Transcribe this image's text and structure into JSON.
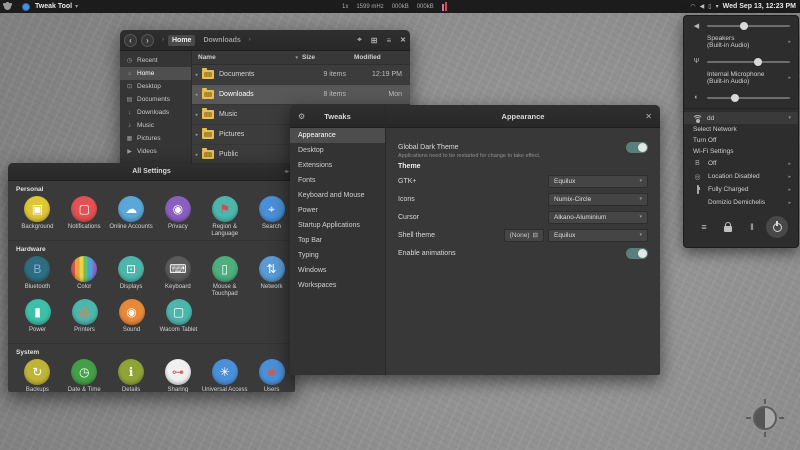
{
  "colors": {
    "accent": "#587f7b",
    "folder": "#e9c050"
  },
  "glyphs": {
    "caret_down": "▾",
    "chevron": "›",
    "back": "‹",
    "forward": "›",
    "expander": "▸",
    "sort_desc": "▾",
    "search": "⌖",
    "grid": "⊞",
    "menu": "≡",
    "close": "✕",
    "gear": "⚙",
    "submenu": "›",
    "folder_button": "⊟",
    "tb_network": "◠",
    "tb_volume": "◀",
    "tb_battery": "▯"
  },
  "top_bar": {
    "app_name": "Tweak Tool",
    "monitor": {
      "scale": "1x",
      "cpu": "1599 mHz",
      "net_down": "000kB",
      "net_up": "000kB"
    },
    "clock": "Wed Sep 13, 12:23 PM"
  },
  "files": {
    "path": [
      {
        "label": "Home"
      },
      {
        "label": "Downloads"
      }
    ],
    "sidebar": [
      {
        "label": "Recent",
        "glyph": "◷"
      },
      {
        "label": "Home",
        "glyph": "⌂"
      },
      {
        "label": "Desktop",
        "glyph": "⊡"
      },
      {
        "label": "Documents",
        "glyph": "▤"
      },
      {
        "label": "Downloads",
        "glyph": "↓"
      },
      {
        "label": "Music",
        "glyph": "♪"
      },
      {
        "label": "Pictures",
        "glyph": "▦"
      },
      {
        "label": "Videos",
        "glyph": "▶"
      }
    ],
    "columns": {
      "name": "Name",
      "size": "Size",
      "modified": "Modified"
    },
    "rows": [
      {
        "name": "Documents",
        "size": "9 items",
        "modified": "12:19 PM"
      },
      {
        "name": "Downloads",
        "size": "8 items",
        "modified": "Mon"
      },
      {
        "name": "Music",
        "size": "",
        "modified": ""
      },
      {
        "name": "Pictures",
        "size": "",
        "modified": ""
      },
      {
        "name": "Public",
        "size": "",
        "modified": ""
      }
    ]
  },
  "settings": {
    "title": "All Settings",
    "sections": [
      {
        "label": "Personal",
        "items": [
          {
            "label": "Background",
            "color": "#ddc735",
            "glyph": "▣"
          },
          {
            "label": "Notifications",
            "color": "#e25252",
            "glyph": "▢"
          },
          {
            "label": "Online Accounts",
            "color": "#5aa7d8",
            "glyph": "☁"
          },
          {
            "label": "Privacy",
            "color": "#8b5fbf",
            "glyph": "◉"
          },
          {
            "label": "Region & Language",
            "color": "#4db6ac",
            "glyph": "⚑"
          },
          {
            "label": "Search",
            "color": "#4a90d9",
            "glyph": "⌖"
          }
        ]
      },
      {
        "label": "Hardware",
        "items": [
          {
            "label": "Bluetooth",
            "color": "#2e6e7e",
            "glyph": "B"
          },
          {
            "label": "Color",
            "color": "#cccccc",
            "glyph": ""
          },
          {
            "label": "Displays",
            "color": "#4db6ac",
            "glyph": "⊡"
          },
          {
            "label": "Keyboard",
            "color": "#5a5a5a",
            "glyph": "⌨"
          },
          {
            "label": "Mouse & Touchpad",
            "color": "#4caf7d",
            "glyph": "▯"
          },
          {
            "label": "Network",
            "color": "#5b9bd5",
            "glyph": "⇅"
          },
          {
            "label": "Power",
            "color": "#3dbfa8",
            "glyph": "▮"
          },
          {
            "label": "Printers",
            "color": "#4db6ac",
            "glyph": "⎙"
          },
          {
            "label": "Sound",
            "color": "#e8893a",
            "glyph": "◉"
          },
          {
            "label": "Wacom Tablet",
            "color": "#4db6ac",
            "glyph": "▢"
          }
        ]
      },
      {
        "label": "System",
        "items": [
          {
            "label": "Backups",
            "color": "#c0b437",
            "glyph": "↻"
          },
          {
            "label": "Date & Time",
            "color": "#43a047",
            "glyph": "◷"
          },
          {
            "label": "Details",
            "color": "#8fa336",
            "glyph": "ℹ"
          },
          {
            "label": "Sharing",
            "color": "#f0f0f0",
            "glyph": "⊶"
          },
          {
            "label": "Universal Access",
            "color": "#4a90d9",
            "glyph": "✳"
          },
          {
            "label": "Users",
            "color": "#4a90d9",
            "glyph": "☻"
          }
        ]
      }
    ]
  },
  "tweaks": {
    "title": "Tweaks",
    "sidebar": [
      {
        "label": "Appearance"
      },
      {
        "label": "Desktop"
      },
      {
        "label": "Extensions"
      },
      {
        "label": "Fonts"
      },
      {
        "label": "Keyboard and Mouse"
      },
      {
        "label": "Power"
      },
      {
        "label": "Startup Applications"
      },
      {
        "label": "Top Bar"
      },
      {
        "label": "Typing"
      },
      {
        "label": "Windows"
      },
      {
        "label": "Workspaces"
      }
    ],
    "panel": {
      "title": "Appearance",
      "dark_label": "Global Dark Theme",
      "dark_note": "Applications need to be restarted for change to take effect.",
      "theme_header": "Theme",
      "rows": [
        {
          "label": "GTK+",
          "value": "Equilux"
        },
        {
          "label": "Icons",
          "value": "Numix-Circle"
        },
        {
          "label": "Cursor",
          "value": "Alkano-Aluminium"
        },
        {
          "label": "Shell theme",
          "value": "Equilux",
          "file_button": "(None)"
        }
      ],
      "animations_label": "Enable animations"
    }
  },
  "system_menu": {
    "sliders": [
      {
        "name": "volume",
        "glyph": "◀",
        "value_pct": "44%"
      },
      {
        "name": "microphone",
        "glyph": "Ψ",
        "value_pct": "62%"
      },
      {
        "name": "brightness",
        "glyph": "◐",
        "value_pct": "34%"
      }
    ],
    "outputs": [
      {
        "line1": "Speakers",
        "line2": "(Built-in Audio)"
      },
      {
        "line1": "Internal Microphone",
        "line2": "(Built-in Audio)"
      }
    ],
    "wifi": {
      "ssid": "dd",
      "menu": [
        "Select Network",
        "Turn Off",
        "Wi-Fi Settings"
      ]
    },
    "items": [
      {
        "label": "Off",
        "glyph": "B"
      },
      {
        "label": "Location Disabled",
        "glyph": "◎"
      },
      {
        "label": "Fully Charged"
      },
      {
        "label": "Domizio Demichelis"
      }
    ]
  }
}
